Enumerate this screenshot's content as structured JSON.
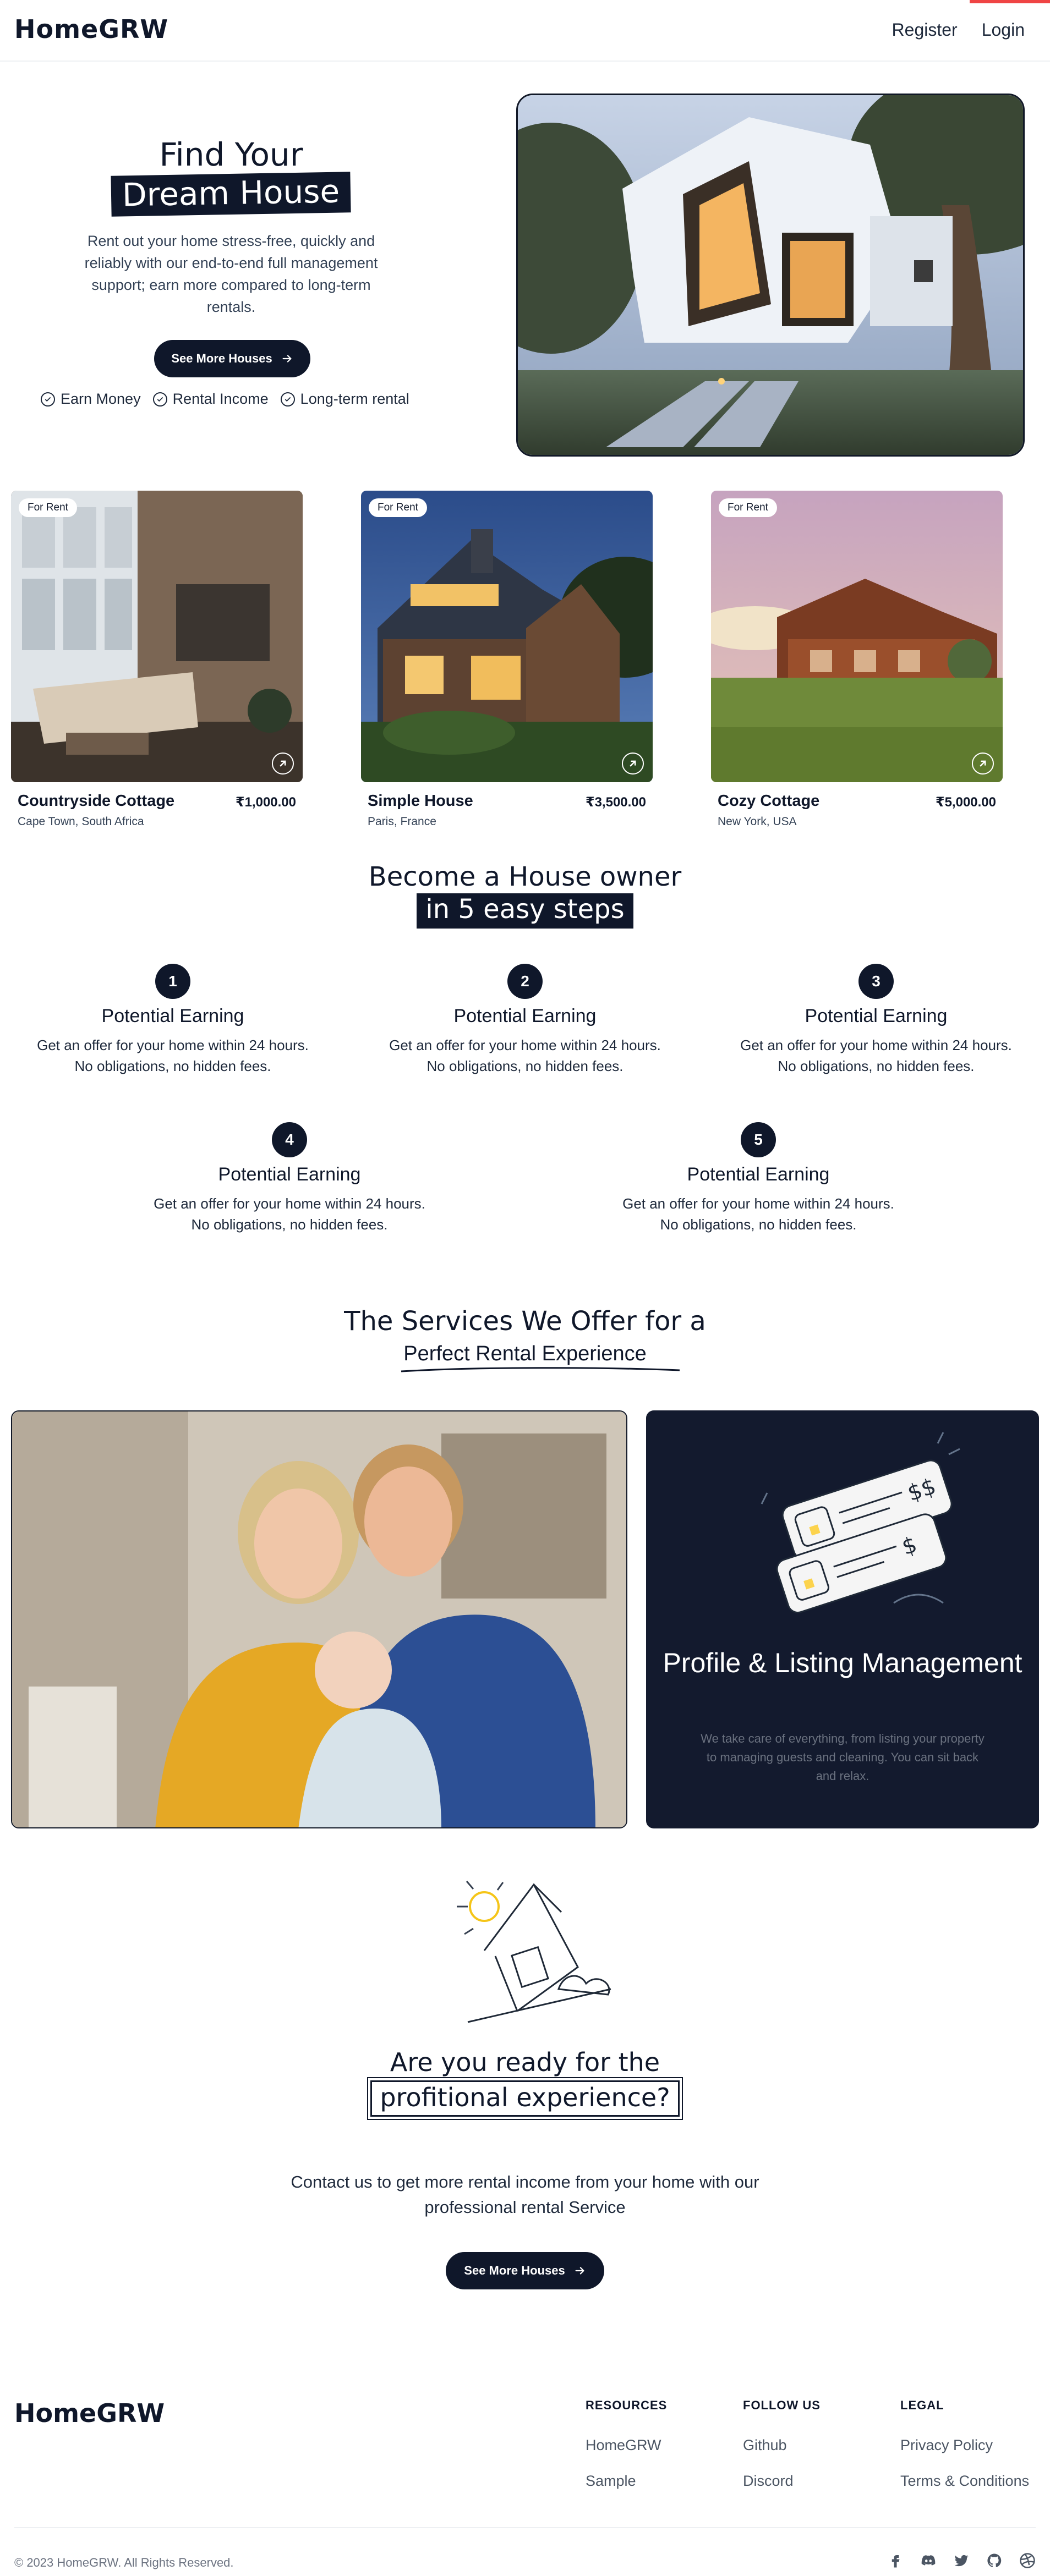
{
  "header": {
    "logo": "HomeGRW",
    "nav": {
      "register": "Register",
      "login": "Login"
    }
  },
  "hero": {
    "title_line1": "Find Your",
    "title_line2": "Dream House",
    "description": "Rent out your home stress-free, quickly and reliably with our end-to-end full management support; earn more compared to long-term rentals.",
    "button": "See More Houses",
    "features": [
      "Earn Money",
      "Rental Income",
      "Long-term rental"
    ]
  },
  "properties": [
    {
      "badge": "For Rent",
      "name": "Countryside Cottage",
      "price": "₹1,000.00",
      "location": "Cape Town, South Africa"
    },
    {
      "badge": "For Rent",
      "name": "Simple House",
      "price": "₹3,500.00",
      "location": "Paris, France"
    },
    {
      "badge": "For Rent",
      "name": "Cozy Cottage",
      "price": "₹5,000.00",
      "location": "New York, USA"
    }
  ],
  "steps": {
    "title_line1": "Become a House owner",
    "title_line2": "in 5 easy steps",
    "items": [
      {
        "num": "1",
        "title": "Potential Earning",
        "desc": "Get an offer for your home within 24 hours. No obligations, no hidden fees."
      },
      {
        "num": "2",
        "title": "Potential Earning",
        "desc": "Get an offer for your home within 24 hours. No obligations, no hidden fees."
      },
      {
        "num": "3",
        "title": "Potential Earning",
        "desc": "Get an offer for your home within 24 hours. No obligations, no hidden fees."
      },
      {
        "num": "4",
        "title": "Potential Earning",
        "desc": "Get an offer for your home within 24 hours. No obligations, no hidden fees."
      },
      {
        "num": "5",
        "title": "Potential Earning",
        "desc": "Get an offer for your home within 24 hours. No obligations, no hidden fees."
      }
    ]
  },
  "services": {
    "title": "The Services We Offer for a",
    "subtitle": "Perfect Rental Experience",
    "card_title": "Profile & Listing Management",
    "card_desc": "We take care of everything, from listing your property to managing guests and cleaning. You can sit back and relax."
  },
  "cta": {
    "title_line1": "Are you ready for the",
    "title_line2": "profitional experience?",
    "description": "Contact us to get more rental income from your home with our professional rental Service",
    "button": "See More Houses"
  },
  "footer": {
    "logo": "HomeGRW",
    "columns": [
      {
        "heading": "RESOURCES",
        "links": [
          "HomeGRW",
          "Sample"
        ]
      },
      {
        "heading": "FOLLOW US",
        "links": [
          "Github",
          "Discord"
        ]
      },
      {
        "heading": "LEGAL",
        "links": [
          "Privacy Policy",
          "Terms & Conditions"
        ]
      }
    ],
    "copyright": "© 2023 HomeGRW. All Rights Reserved.",
    "social_icons": [
      "facebook-icon",
      "discord-icon",
      "twitter-icon",
      "github-icon",
      "dribbble-icon"
    ]
  },
  "colors": {
    "primary": "#0f172a",
    "accent": "#ef4444",
    "card_dark": "#131a2e"
  }
}
